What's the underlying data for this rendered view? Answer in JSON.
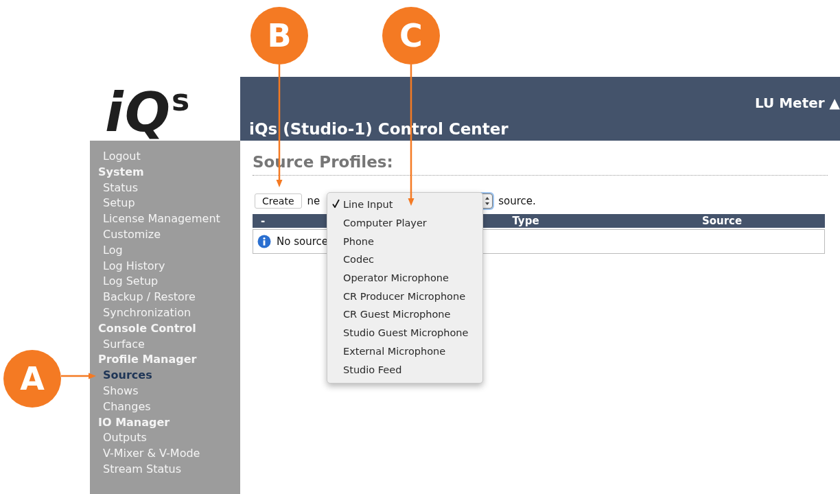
{
  "logo": "iQ$^{s}$",
  "sidebar": {
    "items": [
      {
        "label": "Logout",
        "kind": "link",
        "selected": false
      },
      {
        "label": "System",
        "kind": "group",
        "selected": false
      },
      {
        "label": "Status",
        "kind": "link",
        "selected": false
      },
      {
        "label": "Setup",
        "kind": "link",
        "selected": false
      },
      {
        "label": "License Management",
        "kind": "link",
        "selected": false
      },
      {
        "label": "Customize",
        "kind": "link",
        "selected": false
      },
      {
        "label": "Log",
        "kind": "link",
        "selected": false
      },
      {
        "label": "Log History",
        "kind": "link",
        "selected": false
      },
      {
        "label": "Log Setup",
        "kind": "link",
        "selected": false
      },
      {
        "label": "Backup / Restore",
        "kind": "link",
        "selected": false
      },
      {
        "label": "Synchronization",
        "kind": "link",
        "selected": false
      },
      {
        "label": "Console Control",
        "kind": "group",
        "selected": false
      },
      {
        "label": "Surface",
        "kind": "link",
        "selected": false
      },
      {
        "label": "Profile Manager",
        "kind": "group",
        "selected": false
      },
      {
        "label": "Sources",
        "kind": "link",
        "selected": true
      },
      {
        "label": "Shows",
        "kind": "link",
        "selected": false
      },
      {
        "label": "Changes",
        "kind": "link",
        "selected": false
      },
      {
        "label": "IO Manager",
        "kind": "group",
        "selected": false
      },
      {
        "label": "Outputs",
        "kind": "link",
        "selected": false
      },
      {
        "label": "V-Mixer & V-Mode",
        "kind": "link",
        "selected": false
      },
      {
        "label": "Stream Status",
        "kind": "link",
        "selected": false
      }
    ]
  },
  "header": {
    "title": "iQs (Studio-1) Control Center",
    "meter_button": "LU Meter ▲"
  },
  "page": {
    "heading": "Source Profiles:",
    "create_button": "Create",
    "sentence_start": "ne",
    "sentence_end": "source.",
    "table": {
      "columns": [
        {
          "label": "-"
        },
        {
          "label": "Type"
        },
        {
          "label": "Source"
        }
      ],
      "empty_message": "No source"
    }
  },
  "dropdown": {
    "options": [
      {
        "label": "Line Input",
        "selected": true
      },
      {
        "label": "Computer Player",
        "selected": false
      },
      {
        "label": "Phone",
        "selected": false
      },
      {
        "label": "Codec",
        "selected": false
      },
      {
        "label": "Operator Microphone",
        "selected": false
      },
      {
        "label": "CR Producer Microphone",
        "selected": false
      },
      {
        "label": "CR Guest Microphone",
        "selected": false
      },
      {
        "label": "Studio Guest Microphone",
        "selected": false
      },
      {
        "label": "External Microphone",
        "selected": false
      },
      {
        "label": "Studio Feed",
        "selected": false
      }
    ]
  },
  "callouts": [
    {
      "letter": "A"
    },
    {
      "letter": "B"
    },
    {
      "letter": "C"
    }
  ]
}
